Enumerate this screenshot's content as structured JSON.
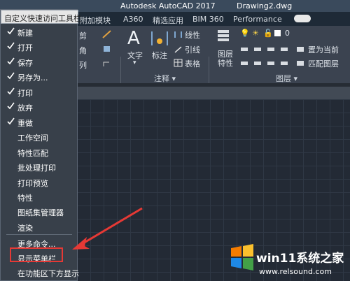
{
  "title_bar": {
    "app": "Autodesk AutoCAD 2017",
    "file": "Drawing2.dwg"
  },
  "ribbon_tabs": [
    "附加模块",
    "A360",
    "精选应用",
    "BIM 360",
    "Performance"
  ],
  "ribbon": {
    "annotation": {
      "text_label": "文字",
      "dimension_label": "标注",
      "linear_label": "线性",
      "leader_label": "引线",
      "table_label": "表格",
      "panel_title": "注释 ▾"
    },
    "layers": {
      "layer_properties_label": "图层\n特性",
      "current_layer_value": "0",
      "set_current_label": "置为当前",
      "match_layer_label": "匹配图层",
      "panel_title": "图层 ▾"
    },
    "partial_left": [
      "剪",
      "角",
      "列"
    ]
  },
  "qat_menu": {
    "header": "自定义快速访问工具栏",
    "items": [
      {
        "label": "新建",
        "checked": true
      },
      {
        "label": "打开",
        "checked": true
      },
      {
        "label": "保存",
        "checked": true
      },
      {
        "label": "另存为...",
        "checked": true
      },
      {
        "label": "打印",
        "checked": true
      },
      {
        "label": "放弃",
        "checked": true
      },
      {
        "label": "重做",
        "checked": true
      },
      {
        "label": "工作空间",
        "checked": false
      },
      {
        "label": "特性匹配",
        "checked": false
      },
      {
        "label": "批处理打印",
        "checked": false
      },
      {
        "label": "打印预览",
        "checked": false
      },
      {
        "label": "特性",
        "checked": false
      },
      {
        "label": "图纸集管理器",
        "checked": false
      },
      {
        "label": "渲染",
        "checked": false
      }
    ],
    "more_commands": "更多命令...",
    "show_menubar": "显示菜单栏",
    "show_below_ribbon": "在功能区下方显示"
  },
  "watermark": {
    "brand": "win11系统之家",
    "url": "www.relsound.com"
  },
  "colors": {
    "highlight": "#e53935",
    "arrow": "#e53935"
  }
}
